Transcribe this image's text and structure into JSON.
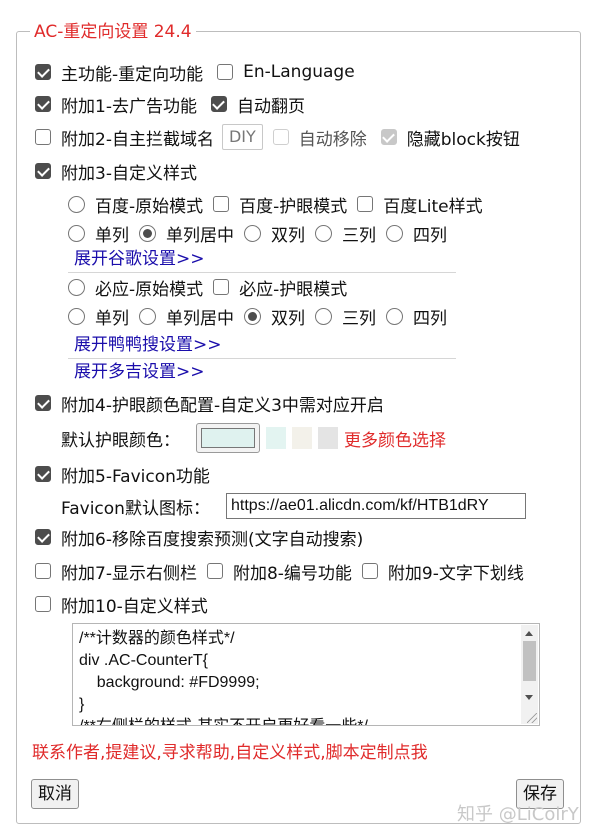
{
  "legend": "AC-重定向设置 24.4",
  "rows": {
    "r1": {
      "a": "主功能-重定向功能",
      "b": "En-Language"
    },
    "r2": {
      "a": "附加1-去广告功能",
      "b": "自动翻页"
    },
    "r3": {
      "a": "附加2-自主拦截域名",
      "diy": "DIY",
      "b": "自动移除",
      "c": "隐藏block按钮"
    },
    "r4": {
      "a": "附加3-自定义样式"
    },
    "baidu": {
      "o1": "百度-原始模式",
      "o2": "百度-护眼模式",
      "o3": "百度Lite样式"
    },
    "cols1": {
      "c1": "单列",
      "c2": "单列居中",
      "c3": "双列",
      "c4": "三列",
      "c5": "四列"
    },
    "google_link": "展开谷歌设置>>",
    "bing": {
      "o1": "必应-原始模式",
      "o2": "必应-护眼模式"
    },
    "cols2": {
      "c1": "单列",
      "c2": "单列居中",
      "c3": "双列",
      "c4": "三列",
      "c5": "四列"
    },
    "ddg_link": "展开鸭鸭搜设置>>",
    "dogedoge_link": "展开多吉设置>>",
    "r5": {
      "a": "附加4-护眼颜色配置-自定义3中需对应开启"
    },
    "eye": {
      "label": "默认护眼颜色：",
      "color": "#dff2ef",
      "swatches": [
        "#e3f4f1",
        "#f3f1ea",
        "#e4e4e4"
      ],
      "more": "更多颜色选择"
    },
    "r6": {
      "a": "附加5-Favicon功能"
    },
    "favicon": {
      "label": "Favicon默认图标：",
      "value": "https://ae01.alicdn.com/kf/HTB1dRY"
    },
    "r7": {
      "a": "附加6-移除百度搜索预测(文字自动搜索)"
    },
    "r8": {
      "a": "附加7-显示右侧栏",
      "b": "附加8-编号功能",
      "c": "附加9-文字下划线"
    },
    "r9": {
      "a": "附加10-自定义样式"
    },
    "css_lines": [
      "/**计数器的颜色样式*/",
      "div .AC-CounterT{",
      "    background: #FD9999;",
      "}",
      "/**右侧栏的样式-其实不开启更好看一些*/"
    ],
    "contact": "联系作者,提建议,寻求帮助,自定义样式,脚本定制点我",
    "cancel": "取消",
    "save": "保存",
    "watermark": "知乎 @LiColrY"
  }
}
